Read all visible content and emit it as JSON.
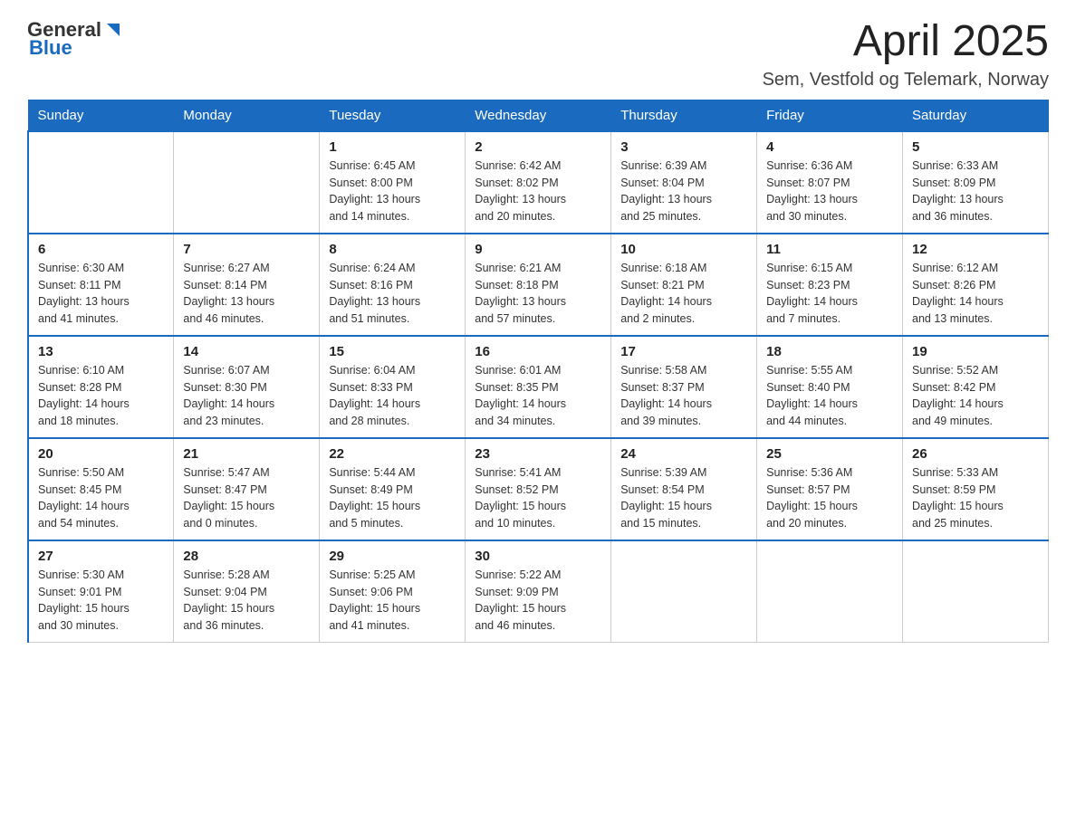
{
  "header": {
    "logo_general": "General",
    "logo_blue": "Blue",
    "title": "April 2025",
    "subtitle": "Sem, Vestfold og Telemark, Norway"
  },
  "weekdays": [
    "Sunday",
    "Monday",
    "Tuesday",
    "Wednesday",
    "Thursday",
    "Friday",
    "Saturday"
  ],
  "weeks": [
    [
      {
        "day": "",
        "info": ""
      },
      {
        "day": "",
        "info": ""
      },
      {
        "day": "1",
        "info": "Sunrise: 6:45 AM\nSunset: 8:00 PM\nDaylight: 13 hours\nand 14 minutes."
      },
      {
        "day": "2",
        "info": "Sunrise: 6:42 AM\nSunset: 8:02 PM\nDaylight: 13 hours\nand 20 minutes."
      },
      {
        "day": "3",
        "info": "Sunrise: 6:39 AM\nSunset: 8:04 PM\nDaylight: 13 hours\nand 25 minutes."
      },
      {
        "day": "4",
        "info": "Sunrise: 6:36 AM\nSunset: 8:07 PM\nDaylight: 13 hours\nand 30 minutes."
      },
      {
        "day": "5",
        "info": "Sunrise: 6:33 AM\nSunset: 8:09 PM\nDaylight: 13 hours\nand 36 minutes."
      }
    ],
    [
      {
        "day": "6",
        "info": "Sunrise: 6:30 AM\nSunset: 8:11 PM\nDaylight: 13 hours\nand 41 minutes."
      },
      {
        "day": "7",
        "info": "Sunrise: 6:27 AM\nSunset: 8:14 PM\nDaylight: 13 hours\nand 46 minutes."
      },
      {
        "day": "8",
        "info": "Sunrise: 6:24 AM\nSunset: 8:16 PM\nDaylight: 13 hours\nand 51 minutes."
      },
      {
        "day": "9",
        "info": "Sunrise: 6:21 AM\nSunset: 8:18 PM\nDaylight: 13 hours\nand 57 minutes."
      },
      {
        "day": "10",
        "info": "Sunrise: 6:18 AM\nSunset: 8:21 PM\nDaylight: 14 hours\nand 2 minutes."
      },
      {
        "day": "11",
        "info": "Sunrise: 6:15 AM\nSunset: 8:23 PM\nDaylight: 14 hours\nand 7 minutes."
      },
      {
        "day": "12",
        "info": "Sunrise: 6:12 AM\nSunset: 8:26 PM\nDaylight: 14 hours\nand 13 minutes."
      }
    ],
    [
      {
        "day": "13",
        "info": "Sunrise: 6:10 AM\nSunset: 8:28 PM\nDaylight: 14 hours\nand 18 minutes."
      },
      {
        "day": "14",
        "info": "Sunrise: 6:07 AM\nSunset: 8:30 PM\nDaylight: 14 hours\nand 23 minutes."
      },
      {
        "day": "15",
        "info": "Sunrise: 6:04 AM\nSunset: 8:33 PM\nDaylight: 14 hours\nand 28 minutes."
      },
      {
        "day": "16",
        "info": "Sunrise: 6:01 AM\nSunset: 8:35 PM\nDaylight: 14 hours\nand 34 minutes."
      },
      {
        "day": "17",
        "info": "Sunrise: 5:58 AM\nSunset: 8:37 PM\nDaylight: 14 hours\nand 39 minutes."
      },
      {
        "day": "18",
        "info": "Sunrise: 5:55 AM\nSunset: 8:40 PM\nDaylight: 14 hours\nand 44 minutes."
      },
      {
        "day": "19",
        "info": "Sunrise: 5:52 AM\nSunset: 8:42 PM\nDaylight: 14 hours\nand 49 minutes."
      }
    ],
    [
      {
        "day": "20",
        "info": "Sunrise: 5:50 AM\nSunset: 8:45 PM\nDaylight: 14 hours\nand 54 minutes."
      },
      {
        "day": "21",
        "info": "Sunrise: 5:47 AM\nSunset: 8:47 PM\nDaylight: 15 hours\nand 0 minutes."
      },
      {
        "day": "22",
        "info": "Sunrise: 5:44 AM\nSunset: 8:49 PM\nDaylight: 15 hours\nand 5 minutes."
      },
      {
        "day": "23",
        "info": "Sunrise: 5:41 AM\nSunset: 8:52 PM\nDaylight: 15 hours\nand 10 minutes."
      },
      {
        "day": "24",
        "info": "Sunrise: 5:39 AM\nSunset: 8:54 PM\nDaylight: 15 hours\nand 15 minutes."
      },
      {
        "day": "25",
        "info": "Sunrise: 5:36 AM\nSunset: 8:57 PM\nDaylight: 15 hours\nand 20 minutes."
      },
      {
        "day": "26",
        "info": "Sunrise: 5:33 AM\nSunset: 8:59 PM\nDaylight: 15 hours\nand 25 minutes."
      }
    ],
    [
      {
        "day": "27",
        "info": "Sunrise: 5:30 AM\nSunset: 9:01 PM\nDaylight: 15 hours\nand 30 minutes."
      },
      {
        "day": "28",
        "info": "Sunrise: 5:28 AM\nSunset: 9:04 PM\nDaylight: 15 hours\nand 36 minutes."
      },
      {
        "day": "29",
        "info": "Sunrise: 5:25 AM\nSunset: 9:06 PM\nDaylight: 15 hours\nand 41 minutes."
      },
      {
        "day": "30",
        "info": "Sunrise: 5:22 AM\nSunset: 9:09 PM\nDaylight: 15 hours\nand 46 minutes."
      },
      {
        "day": "",
        "info": ""
      },
      {
        "day": "",
        "info": ""
      },
      {
        "day": "",
        "info": ""
      }
    ]
  ]
}
